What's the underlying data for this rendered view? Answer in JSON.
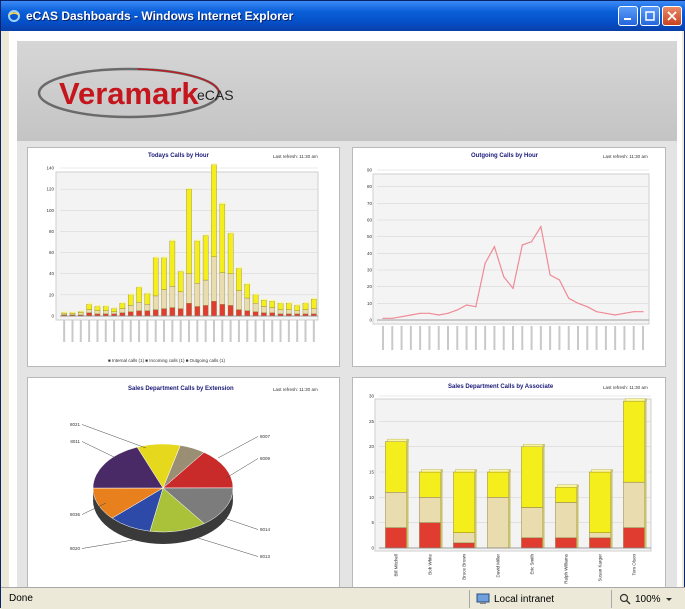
{
  "window": {
    "title": "eCAS Dashboards - Windows Internet Explorer"
  },
  "logo": {
    "brand": "Veramark",
    "product": "eCAS"
  },
  "panels": {
    "top_left": {
      "title": "Todays Calls by Hour",
      "updated": "Last refresh: 11:30 am",
      "legend": "■ Internal calls (1)  ■ Incoming calls (1)  ■ Outgoing calls (1)"
    },
    "top_right": {
      "title": "Outgoing Calls by Hour",
      "updated": "Last refresh: 11:30 am"
    },
    "bottom_left": {
      "title": "Sales Department Calls by Extension",
      "updated": "Last refresh: 11:30 am"
    },
    "bottom_right": {
      "title": "Sales Department Calls by Associate",
      "updated": "Last refresh: 11:30 am",
      "legend": "■ Internal calls (1)  ■ Incoming calls (1)  ■ Outgoing calls (1)"
    }
  },
  "colors": {
    "internal": "#e03c2f",
    "incoming": "#e9ddb0",
    "outgoing": "#f3ee1c",
    "line": "#ef8a96"
  },
  "status": {
    "left": "Done",
    "zone": "Local intranet",
    "zoom": "100%"
  },
  "chart_data": [
    {
      "type": "bar",
      "title": "Todays Calls by Hour",
      "stacked": true,
      "ylim": [
        0,
        140
      ],
      "yticks": [
        0,
        20,
        40,
        60,
        80,
        100,
        120,
        140
      ],
      "categories": [
        "c1",
        "c2",
        "c3",
        "c4",
        "c5",
        "c6",
        "c7",
        "c8",
        "c9",
        "c10",
        "c11",
        "c12",
        "c13",
        "c14",
        "c15",
        "c16",
        "c17",
        "c18",
        "c19",
        "c20",
        "c21",
        "c22",
        "c23",
        "c24",
        "c25",
        "c26",
        "c27",
        "c28",
        "c29",
        "c30",
        "c31"
      ],
      "series": [
        {
          "name": "Internal calls",
          "values": [
            1,
            1,
            1,
            3,
            2,
            2,
            2,
            3,
            4,
            5,
            5,
            6,
            7,
            8,
            7,
            12,
            9,
            10,
            14,
            11,
            10,
            6,
            5,
            4,
            3,
            3,
            2,
            2,
            2,
            2,
            2
          ]
        },
        {
          "name": "Incoming calls",
          "values": [
            1,
            1,
            2,
            3,
            3,
            3,
            2,
            4,
            6,
            8,
            6,
            13,
            18,
            20,
            16,
            28,
            22,
            24,
            42,
            30,
            30,
            18,
            12,
            8,
            6,
            5,
            4,
            4,
            3,
            4,
            5
          ]
        },
        {
          "name": "Outgoing calls",
          "values": [
            1,
            1,
            1,
            5,
            4,
            4,
            3,
            5,
            10,
            14,
            10,
            36,
            30,
            43,
            19,
            80,
            40,
            42,
            87,
            65,
            38,
            21,
            13,
            8,
            6,
            6,
            6,
            6,
            5,
            6,
            9
          ]
        }
      ]
    },
    {
      "type": "line",
      "title": "Outgoing Calls by Hour",
      "ylim": [
        0,
        90
      ],
      "yticks": [
        0,
        10,
        20,
        30,
        40,
        50,
        60,
        70,
        80,
        90
      ],
      "series": [
        {
          "name": "Outgoing calls",
          "values": [
            1,
            1,
            2,
            3,
            4,
            4,
            3,
            4,
            6,
            9,
            8,
            34,
            44,
            26,
            19,
            45,
            47,
            56,
            27,
            24,
            13,
            10,
            8,
            5,
            4,
            3,
            4,
            5,
            5
          ]
        }
      ]
    },
    {
      "type": "pie",
      "title": "Sales Department Calls by Extension",
      "slices": [
        {
          "label": "",
          "value": 6,
          "color": "#9a8f74"
        },
        {
          "label": "",
          "value": 15,
          "color": "#c92a2a"
        },
        {
          "label": "",
          "value": 15,
          "color": "#7c7c7c"
        },
        {
          "label": "",
          "value": 13,
          "color": "#a9c23a"
        },
        {
          "label": "",
          "value": 10,
          "color": "#2e4aa8"
        },
        {
          "label": "",
          "value": 12,
          "color": "#e9801e"
        },
        {
          "label": "",
          "value": 19,
          "color": "#4a2a66"
        },
        {
          "label": "",
          "value": 10,
          "color": "#e6d81c"
        }
      ],
      "labels": [
        "8021",
        "8007",
        "8009",
        "8014",
        "8013",
        "8020",
        "8036",
        "8011"
      ]
    },
    {
      "type": "bar",
      "title": "Sales Department Calls by Associate",
      "stacked": true,
      "ylim": [
        0,
        30
      ],
      "yticks": [
        0,
        5,
        10,
        15,
        20,
        25,
        30
      ],
      "categories": [
        "Bill Mitchell",
        "Bob White",
        "Bruce Brown",
        "David Miller",
        "Eric Smith",
        "Ralph Williams",
        "Susan Karger",
        "Tom Olson"
      ],
      "series": [
        {
          "name": "Internal calls",
          "values": [
            4,
            5,
            1,
            0,
            2,
            2,
            2,
            4
          ]
        },
        {
          "name": "Incoming calls",
          "values": [
            7,
            5,
            2,
            10,
            6,
            7,
            1,
            9
          ]
        },
        {
          "name": "Outgoing calls",
          "values": [
            10,
            5,
            12,
            5,
            12,
            3,
            12,
            16
          ]
        }
      ]
    }
  ]
}
